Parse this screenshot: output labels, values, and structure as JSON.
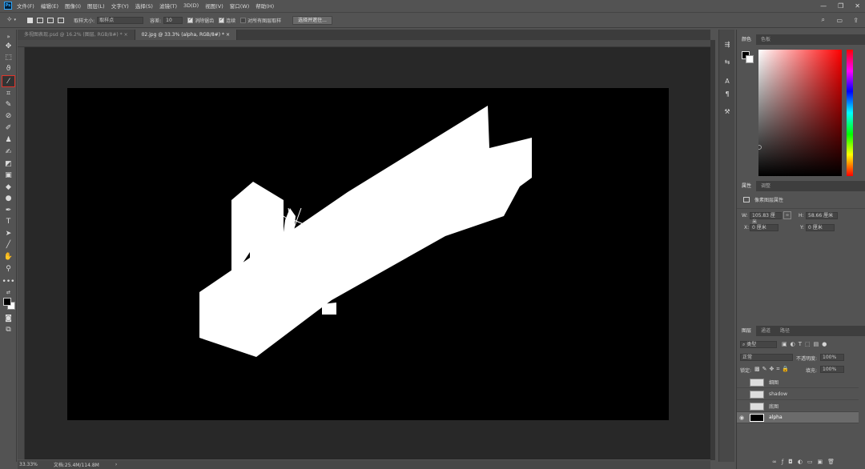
{
  "menu": {
    "logo": "Ps",
    "items": [
      "文件(F)",
      "编辑(E)",
      "图像(I)",
      "图层(L)",
      "文字(Y)",
      "选择(S)",
      "滤镜(T)",
      "3D(D)",
      "视图(V)",
      "窗口(W)",
      "帮助(H)"
    ]
  },
  "window_controls": {
    "minimize": "—",
    "restore": "❐",
    "close": "✕"
  },
  "options": {
    "sample_size_label": "取样大小:",
    "sample_size_value": "取样点",
    "tolerance_label": "容差:",
    "tolerance_value": "10",
    "antialias_label": "消除锯齿",
    "contiguous_label": "连续",
    "sample_all_layers_label": "对所有图层取样",
    "select_subject_button": "选择并遮住..."
  },
  "tabs": [
    {
      "label": "多视图表现.psd @ 16.2% (图层, RGB/8#) *"
    },
    {
      "label": "02.jpg @ 33.3% (alpha, RGB/8#) *"
    }
  ],
  "status": {
    "zoom": "33.33%",
    "doc_size": "文档:25.4M/114.8M",
    "arrow": "›"
  },
  "color_panel": {
    "tabs": [
      "颜色",
      "色板"
    ]
  },
  "properties_panel": {
    "tabs": [
      "属性",
      "调整"
    ],
    "header": "像素图层属性",
    "w_label": "W:",
    "w_value": "105.83 厘米",
    "h_label": "H:",
    "h_value": "58.66 厘米",
    "x_label": "X:",
    "x_value": "0 厘米",
    "y_label": "Y:",
    "y_value": "0 厘米"
  },
  "layers_panel": {
    "tabs": [
      "图层",
      "通道",
      "路径"
    ],
    "filter_kind": "类型",
    "blend_mode": "正常",
    "opacity_label": "不透明度:",
    "opacity_value": "100%",
    "lock_label": "锁定:",
    "fill_label": "填充:",
    "fill_value": "100%",
    "layers": [
      {
        "name": "细图"
      },
      {
        "name": "shadow"
      },
      {
        "name": "底图"
      },
      {
        "name": "alpha"
      }
    ],
    "footer_icons": [
      "link-icon",
      "fx-icon",
      "mask-icon",
      "adjustment-icon",
      "group-icon",
      "new-layer-icon",
      "trash-icon"
    ]
  },
  "accent": {
    "selected_tool_outline": "#e0342a",
    "annotation_arrow": "#e0342a"
  }
}
